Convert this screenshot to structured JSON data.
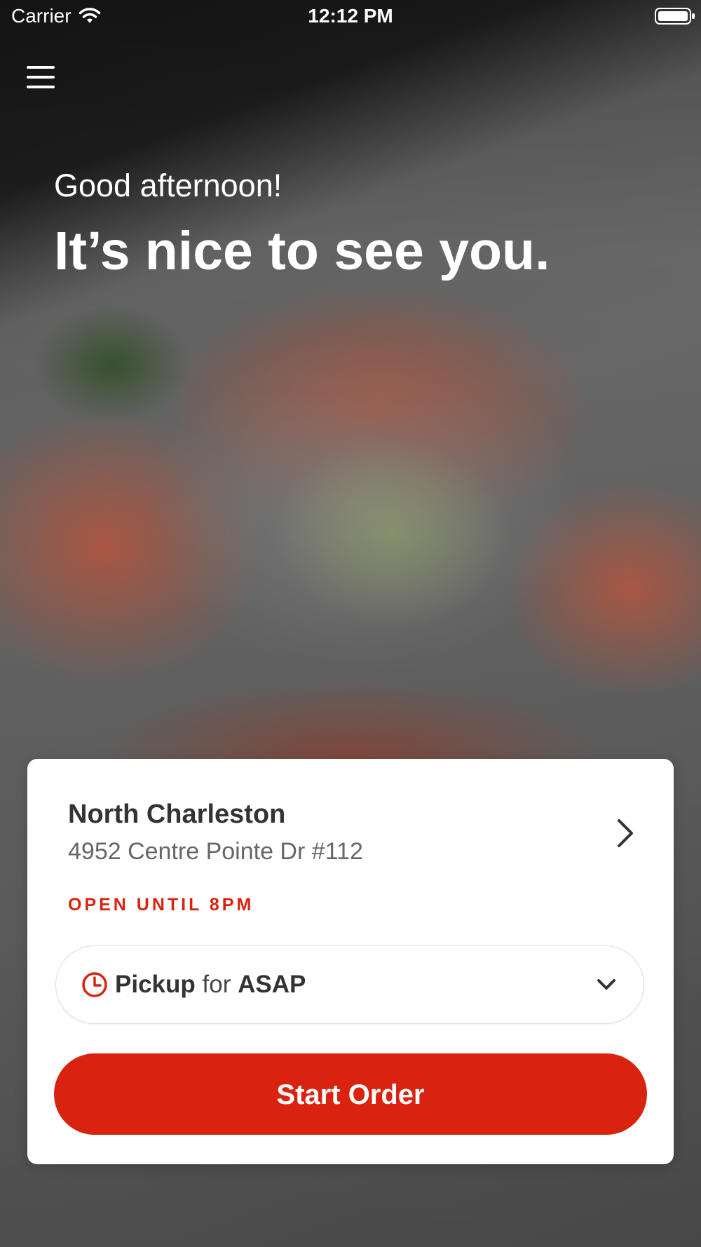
{
  "status_bar": {
    "carrier": "Carrier",
    "time": "12:12 PM"
  },
  "menu_icon": "hamburger-menu-icon",
  "hero": {
    "greeting": "Good afternoon!",
    "headline": "It’s nice to see you."
  },
  "location_card": {
    "name": "North Charleston",
    "address": "4952 Centre Pointe Dr #112",
    "hours": "OPEN UNTIL 8PM",
    "order_mode": {
      "method": "Pickup",
      "connector": "for",
      "time": "ASAP"
    },
    "start_button": "Start Order"
  },
  "colors": {
    "accent": "#d9230f",
    "card_background": "#ffffff",
    "text_dark": "#333333"
  }
}
